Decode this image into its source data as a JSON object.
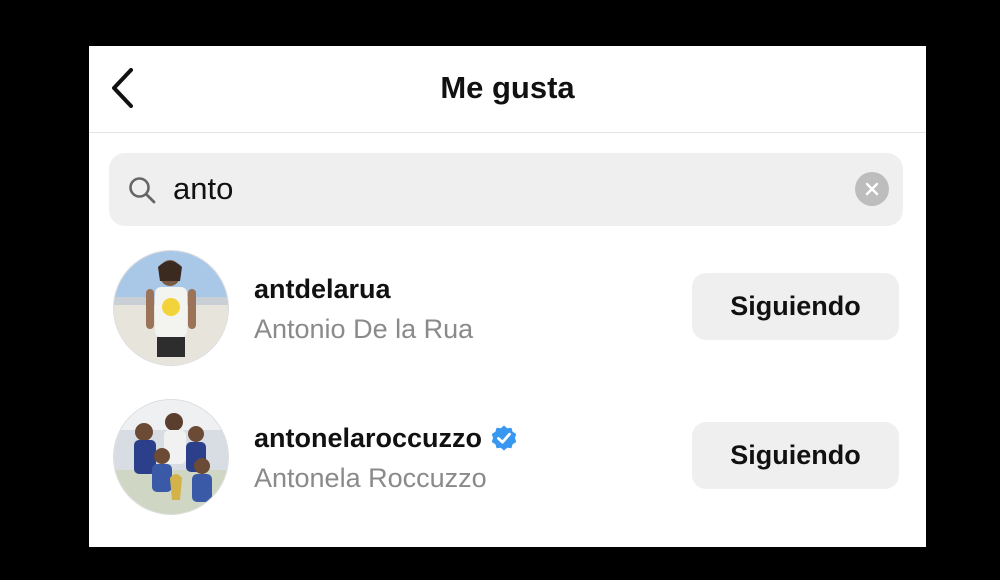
{
  "header": {
    "title": "Me gusta",
    "back_icon": "chevron-left-icon"
  },
  "search": {
    "value": "anto",
    "search_icon": "search-icon",
    "clear_icon": "clear-icon"
  },
  "results": [
    {
      "username": "antdelarua",
      "full_name": "Antonio De la Rua",
      "verified": false,
      "button_label": "Siguiendo"
    },
    {
      "username": "antonelaroccuzzo",
      "full_name": "Antonela Roccuzzo",
      "verified": true,
      "button_label": "Siguiendo"
    }
  ],
  "colors": {
    "verified_badge": "#3897f0",
    "secondary_text": "#8a8a8a",
    "button_bg": "#efefef"
  }
}
